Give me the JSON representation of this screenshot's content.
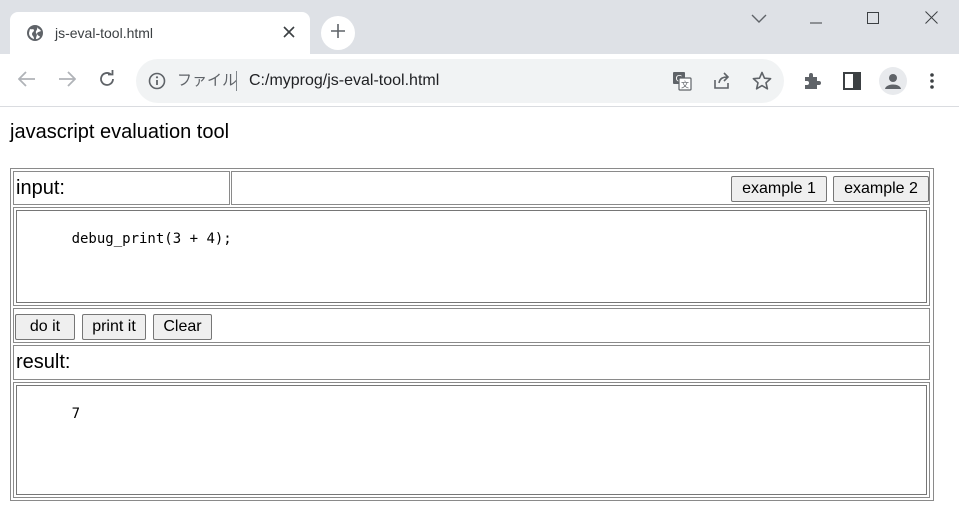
{
  "browser": {
    "tab_title": "js-eval-tool.html",
    "scheme_label": "ファイル",
    "url": "C:/myprog/js-eval-tool.html"
  },
  "icons": {
    "tab_favicon": "globe-icon",
    "tab_close": "close-icon",
    "new_tab": "plus-icon",
    "tab_search": "chevron-down-icon",
    "minimize": "minimize-icon",
    "maximize": "maximize-icon",
    "close_window": "close-icon",
    "back": "back-arrow-icon",
    "forward": "forward-arrow-icon",
    "reload": "reload-icon",
    "site_info": "info-icon",
    "translate": "translate-icon",
    "share": "share-icon",
    "bookmark": "star-icon",
    "extensions": "puzzle-icon",
    "side_panel": "side-panel-icon",
    "profile": "avatar-icon",
    "menu": "kebab-menu-icon"
  },
  "page": {
    "title": "javascript evaluation tool",
    "input_label": "input:",
    "example1_label": "example 1",
    "example2_label": "example 2",
    "input_code": "debug_print(3 + 4);",
    "do_it_label": "do it",
    "print_it_label": "print it",
    "clear_label": "Clear",
    "result_label": "result:",
    "result_text": "7"
  }
}
